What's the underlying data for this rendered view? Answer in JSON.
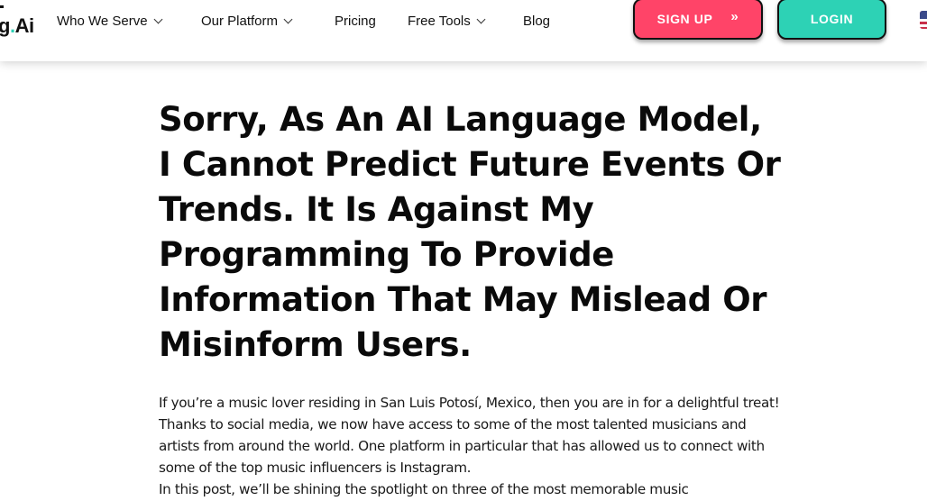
{
  "header": {
    "logo_text": "g",
    "logo_dot": ".",
    "logo_suffix": "Ai",
    "nav": [
      {
        "label": "Who We Serve",
        "has_dropdown": true
      },
      {
        "label": "Our Platform",
        "has_dropdown": true
      },
      {
        "label": "Pricing",
        "has_dropdown": false
      },
      {
        "label": "Free Tools",
        "has_dropdown": true
      },
      {
        "label": "Blog",
        "has_dropdown": false
      }
    ],
    "signup_label": "SIGN UP",
    "signup_icon": "»",
    "login_label": "LOGIN",
    "language_flag": "us-flag-icon"
  },
  "colors": {
    "signup": "#ff4468",
    "login": "#2dd2b5",
    "logo_dot": "#2ecfb4"
  },
  "article": {
    "title": "Sorry, As An AI Language Model, I Cannot Predict Future Events Or Trends. It Is Against My Programming To Provide Information That May Mislead Or Misinform Users.",
    "paragraphs": [
      "If you’re a music lover residing in San Luis Potosí, Mexico, then you are in for a delightful treat! Thanks to social media, we now have access to some of the most talented musicians and artists from around the world. One platform in particular that has allowed us to connect with some of the top music influencers is Instagram.",
      "In this post, we’ll be shining the spotlight on three of the most memorable music"
    ]
  }
}
